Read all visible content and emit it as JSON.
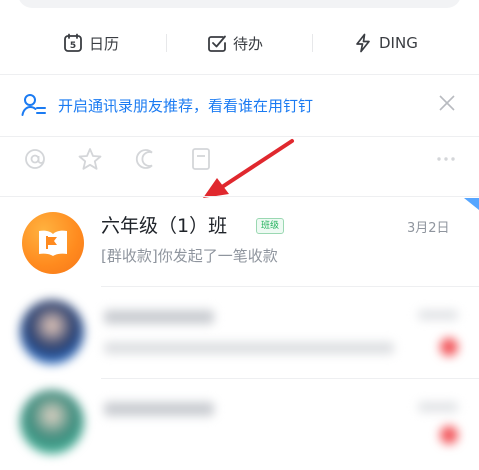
{
  "quick_actions": {
    "calendar_label": "日历",
    "todo_label": "待办",
    "ding_label": "DING",
    "calendar_day": "5"
  },
  "promo": {
    "text": "开启通讯录朋友推荐，看看谁在用钉钉"
  },
  "filters": {
    "icons": [
      "at-icon",
      "star-icon",
      "moon-icon",
      "file-icon",
      "more-icon"
    ]
  },
  "chats": [
    {
      "title": "六年级（1）班",
      "badge": "班级",
      "date": "3月2日",
      "preview": "[群收款]你发起了一笔收款"
    }
  ],
  "colors": {
    "accent": "#1b7bf2",
    "orange": "#ff8a1e",
    "arrow": "#e0282e",
    "badge_green": "#23b25c"
  }
}
